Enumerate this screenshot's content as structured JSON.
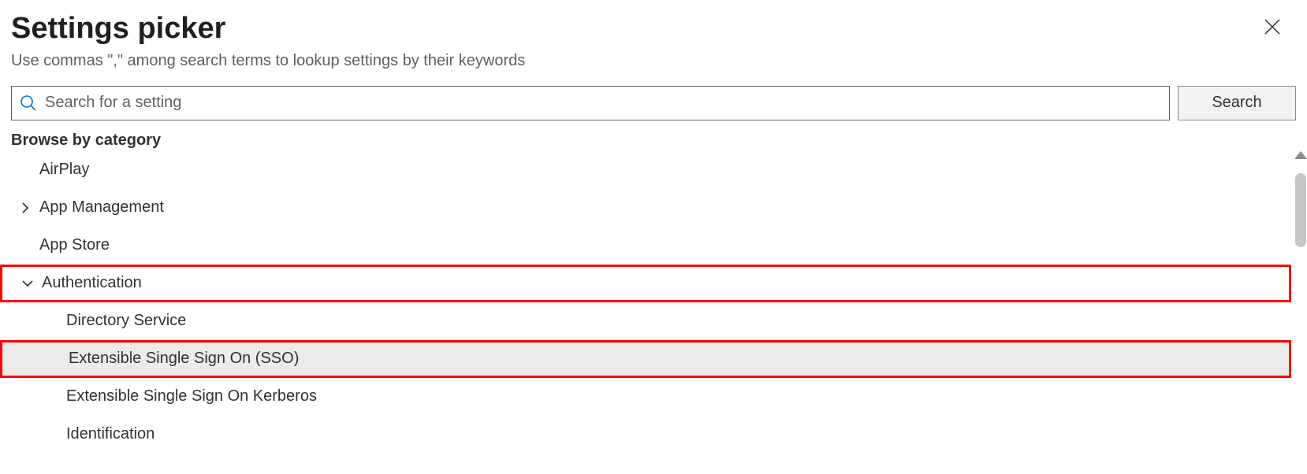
{
  "header": {
    "title": "Settings picker",
    "subtitle": "Use commas \",\" among search terms to lookup settings by their keywords"
  },
  "search": {
    "placeholder": "Search for a setting",
    "button_label": "Search"
  },
  "browse_label": "Browse by category",
  "categories": [
    {
      "label": "AirPlay",
      "expandable": false,
      "depth": 0
    },
    {
      "label": "App Management",
      "expandable": true,
      "expanded": false,
      "depth": 0
    },
    {
      "label": "App Store",
      "expandable": false,
      "depth": 0
    },
    {
      "label": "Authentication",
      "expandable": true,
      "expanded": true,
      "depth": 0,
      "highlighted": true
    },
    {
      "label": "Directory Service",
      "depth": 1
    },
    {
      "label": "Extensible Single Sign On (SSO)",
      "depth": 1,
      "highlighted": true,
      "selected": true
    },
    {
      "label": "Extensible Single Sign On Kerberos",
      "depth": 1
    },
    {
      "label": "Identification",
      "depth": 1
    }
  ]
}
